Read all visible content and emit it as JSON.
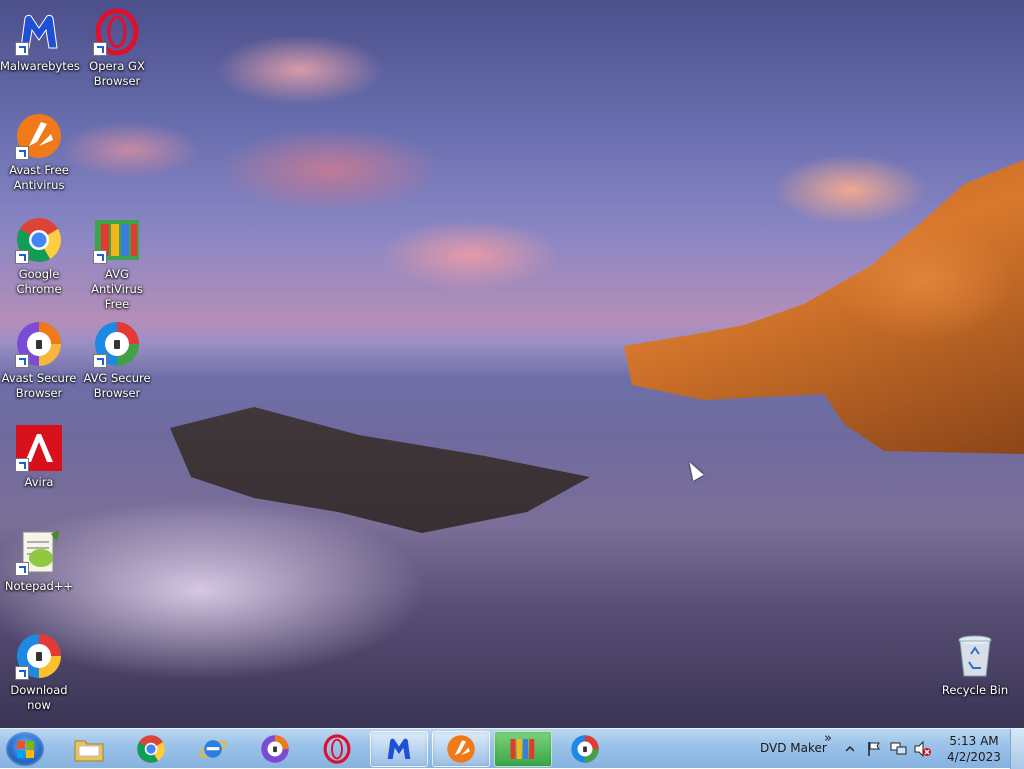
{
  "desktop": {
    "icons": [
      {
        "label": "Malwarebytes",
        "icon": "malwarebytes-icon"
      },
      {
        "label": "Opera GX Browser",
        "icon": "opera-gx-icon"
      },
      {
        "label": "Avast Free Antivirus",
        "icon": "avast-icon"
      },
      {
        "label": "Google Chrome",
        "icon": "chrome-icon"
      },
      {
        "label": "AVG AntiVirus Free",
        "icon": "avg-antivirus-icon"
      },
      {
        "label": "Avast Secure Browser",
        "icon": "avast-secure-browser-icon"
      },
      {
        "label": "AVG Secure Browser",
        "icon": "avg-secure-browser-icon"
      },
      {
        "label": "Avira",
        "icon": "avira-icon"
      },
      {
        "label": "Notepad++",
        "icon": "notepadpp-icon"
      },
      {
        "label": "Download now",
        "icon": "download-now-icon"
      },
      {
        "label": "Recycle Bin",
        "icon": "recycle-bin-icon"
      }
    ]
  },
  "taskbar": {
    "toolbar_label": "DVD Maker",
    "overflow_glyph": "»",
    "clock": {
      "time": "5:13 AM",
      "date": "4/2/2023"
    },
    "pinned": [
      {
        "icon": "file-explorer-icon"
      },
      {
        "icon": "chrome-icon"
      },
      {
        "icon": "internet-explorer-icon"
      },
      {
        "icon": "avast-secure-browser-icon"
      },
      {
        "icon": "opera-icon"
      },
      {
        "icon": "malwarebytes-icon"
      },
      {
        "icon": "avast-icon"
      },
      {
        "icon": "avg-icon"
      },
      {
        "icon": "avg-secure-browser-icon"
      }
    ]
  },
  "colors": {
    "taskbar": "#9cc3ea",
    "malwarebytes": "#1f4fd6",
    "opera": "#e0102c",
    "avast": "#f07a1a",
    "avira": "#d8101c"
  }
}
